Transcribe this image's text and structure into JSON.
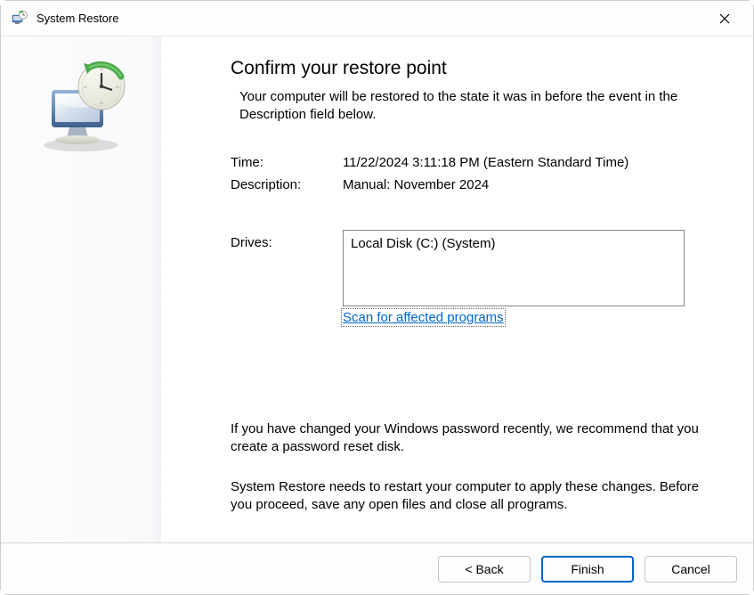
{
  "titlebar": {
    "title": "System Restore"
  },
  "main": {
    "heading": "Confirm your restore point",
    "subheading": "Your computer will be restored to the state it was in before the event in the Description field below.",
    "time_label": "Time:",
    "time_value": "11/22/2024 3:11:18 PM (Eastern Standard Time)",
    "description_label": "Description:",
    "description_value": "Manual: November 2024",
    "drives_label": "Drives:",
    "drives_value": "Local Disk (C:) (System)",
    "scan_link": "Scan for affected programs",
    "warning1": "If you have changed your Windows password recently, we recommend that you create a password reset disk.",
    "warning2": "System Restore needs to restart your computer to apply these changes. Before you proceed, save any open files and close all programs."
  },
  "footer": {
    "back": "< Back",
    "finish": "Finish",
    "cancel": "Cancel"
  }
}
